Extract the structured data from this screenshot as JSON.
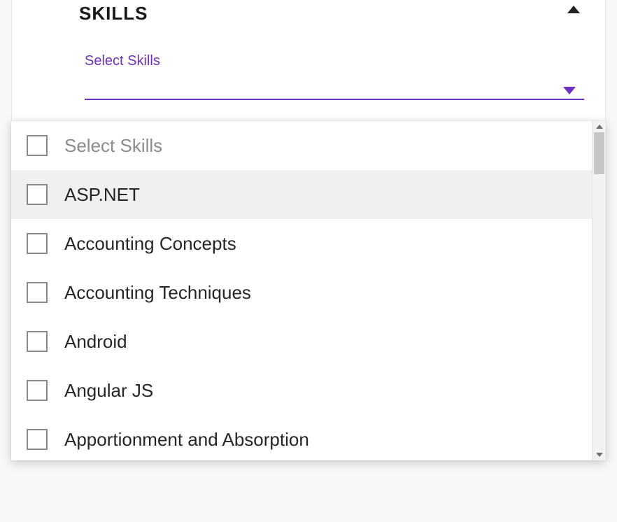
{
  "section": {
    "title": "SKILLS"
  },
  "select": {
    "label": "Select Skills"
  },
  "dropdown": {
    "options": [
      {
        "label": "Select Skills",
        "placeholder": true,
        "hover": false
      },
      {
        "label": "ASP.NET",
        "placeholder": false,
        "hover": true
      },
      {
        "label": "Accounting Concepts",
        "placeholder": false,
        "hover": false
      },
      {
        "label": "Accounting Techniques",
        "placeholder": false,
        "hover": false
      },
      {
        "label": "Android",
        "placeholder": false,
        "hover": false
      },
      {
        "label": "Angular JS",
        "placeholder": false,
        "hover": false
      },
      {
        "label": "Apportionment and Absorption",
        "placeholder": false,
        "hover": false
      }
    ]
  }
}
